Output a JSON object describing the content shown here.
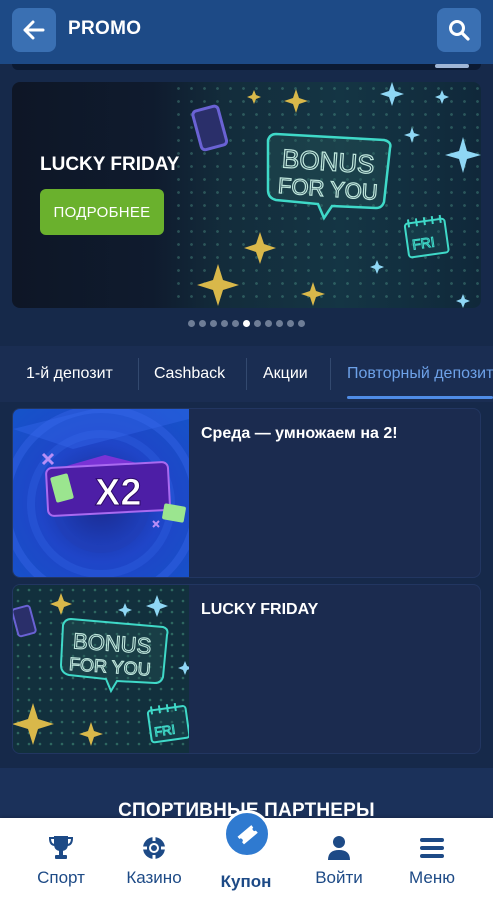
{
  "header": {
    "title": "PROMO",
    "back_icon": "arrow-left-icon",
    "search_icon": "search-icon"
  },
  "banner": {
    "title": "LUCKY FRIDAY",
    "cta_label": "ПОДРОБНЕЕ",
    "art_text_line1": "BONUS",
    "art_text_line2": "FOR YOU",
    "art_badge": "FRI",
    "colors": {
      "cta": "#6ab12d",
      "neon": "#3fd9c8"
    }
  },
  "carousel": {
    "total_slides": 11,
    "active_index": 5
  },
  "tabs": [
    {
      "label": "1-й депозит"
    },
    {
      "label": "Cashback"
    },
    {
      "label": "Акции"
    },
    {
      "label": "Повторный депозит"
    }
  ],
  "promos": [
    {
      "title": "Среда — умножаем на 2!",
      "thumb_text": "X2"
    },
    {
      "title": "LUCKY FRIDAY",
      "thumb_line1": "BONUS",
      "thumb_line2": "FOR YOU",
      "thumb_badge": "FRI"
    }
  ],
  "partners": {
    "title": "СПОРТИВНЫЕ ПАРТНЕРЫ"
  },
  "nav": {
    "sport": "Спорт",
    "casino": "Казино",
    "coupon": "Купон",
    "login": "Войти",
    "menu": "Меню"
  },
  "colors": {
    "header": "#1d4a86",
    "accent": "#2f7ad0",
    "active_tab": "#6da1e8"
  }
}
